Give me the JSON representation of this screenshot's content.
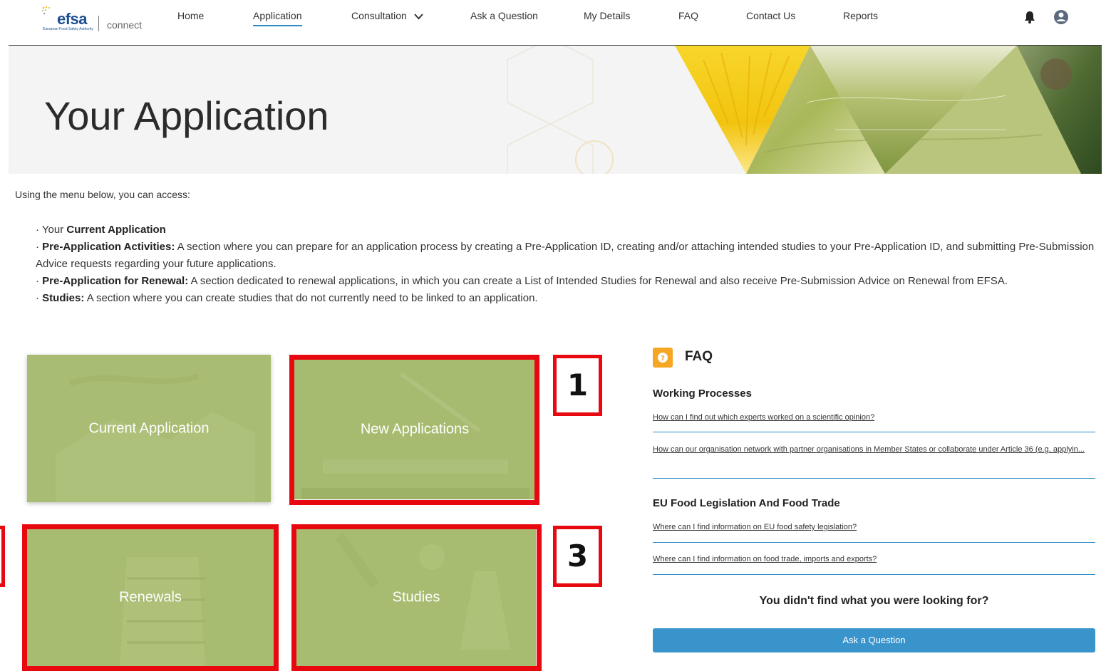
{
  "header": {
    "logo_text": "efsa",
    "logo_subtitle": "European Food Safety Authority",
    "logo_product": "connect",
    "nav": [
      {
        "label": "Home"
      },
      {
        "label": "Application",
        "active": true
      },
      {
        "label": "Consultation",
        "has_dropdown": true
      },
      {
        "label": "Ask a Question"
      },
      {
        "label": "My Details"
      },
      {
        "label": "FAQ"
      },
      {
        "label": "Contact Us"
      },
      {
        "label": "Reports"
      }
    ],
    "icons": [
      "bell-icon",
      "user-avatar-icon"
    ]
  },
  "hero": {
    "title": "Your Application"
  },
  "intro": {
    "lead": "Using the menu below, you can access:",
    "bullets": [
      {
        "prefix": "· Your ",
        "bold": "Current Application",
        "text": ""
      },
      {
        "prefix": "· ",
        "bold": "Pre-Application Activities:",
        "text": " A section where you can prepare for an application process by creating a Pre-Application ID, creating and/or attaching intended studies to your Pre-Application ID, and submitting Pre-Submission Advice requests regarding your future applications."
      },
      {
        "prefix": "· ",
        "bold": "Pre-Application for Renewal:",
        "text": " A section dedicated to renewal applications, in which you can create a List of Intended Studies for Renewal and also receive Pre-Submission Advice on Renewal from EFSA."
      },
      {
        "prefix": "· ",
        "bold": "Studies:",
        "text": " A section where you can create studies that do not currently need to be linked to an application."
      }
    ]
  },
  "tiles": {
    "current": "Current Application",
    "new": "New Applications",
    "renewals": "Renewals",
    "studies": "Studies"
  },
  "callouts": {
    "c1": "1",
    "c3": "3"
  },
  "faq": {
    "title": "FAQ",
    "sections": [
      {
        "heading": "Working Processes",
        "links": [
          "How can I find out which experts worked on a scientific opinion?",
          "How can our organisation network with partner organisations in Member States or collaborate under Article 36 (e.g. applyin..."
        ]
      },
      {
        "heading": "EU Food Legislation And Food Trade",
        "links": [
          "Where can I find information on EU food safety legislation?",
          "Where can I find information on food trade, imports and exports?"
        ]
      }
    ],
    "not_found": "You didn't find what you were looking for?",
    "ask_button": "Ask a Question"
  },
  "colors": {
    "accent_blue": "#3a94cc",
    "tile_green": "#a9bd74",
    "highlight_red": "#e8080f",
    "faq_icon_orange": "#f5a623"
  }
}
